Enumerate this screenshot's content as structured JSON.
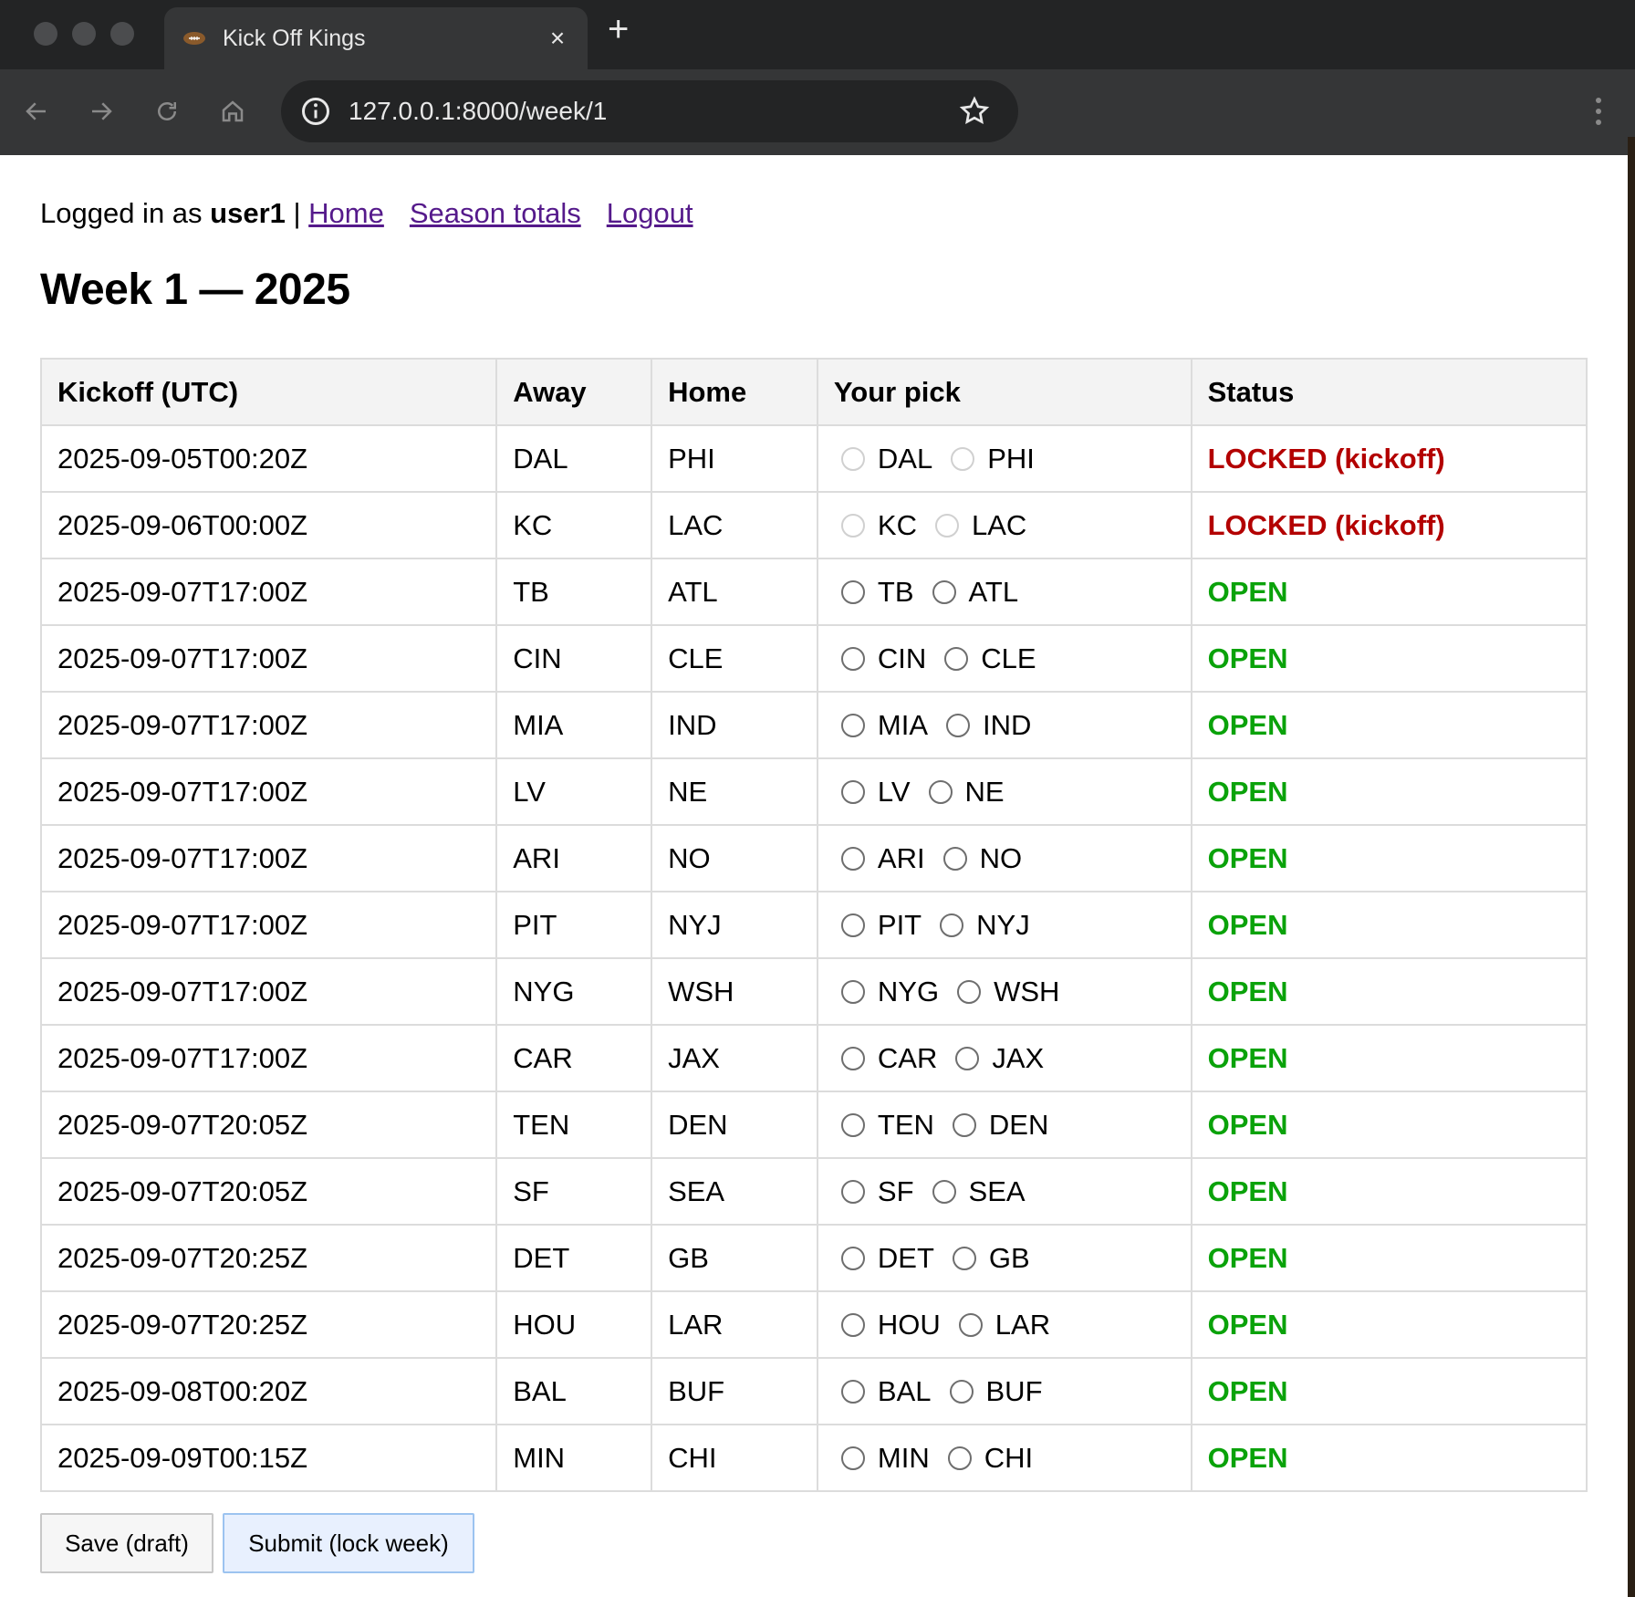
{
  "browser": {
    "tab_title": "Kick Off Kings",
    "tab_close": "×",
    "new_tab": "+",
    "url": "127.0.0.1:8000/week/1"
  },
  "userbar": {
    "prefix": "Logged in as ",
    "username": "user1",
    "separator": " | ",
    "links": {
      "home": "Home",
      "season_totals": "Season totals",
      "logout": "Logout"
    }
  },
  "page_title": "Week 1 — 2025",
  "table": {
    "headers": [
      "Kickoff (UTC)",
      "Away",
      "Home",
      "Your pick",
      "Status"
    ],
    "rows": [
      {
        "kickoff": "2025-09-05T00:20Z",
        "away": "DAL",
        "home": "PHI",
        "status": "LOCKED (kickoff)",
        "locked": true
      },
      {
        "kickoff": "2025-09-06T00:00Z",
        "away": "KC",
        "home": "LAC",
        "status": "LOCKED (kickoff)",
        "locked": true
      },
      {
        "kickoff": "2025-09-07T17:00Z",
        "away": "TB",
        "home": "ATL",
        "status": "OPEN",
        "locked": false
      },
      {
        "kickoff": "2025-09-07T17:00Z",
        "away": "CIN",
        "home": "CLE",
        "status": "OPEN",
        "locked": false
      },
      {
        "kickoff": "2025-09-07T17:00Z",
        "away": "MIA",
        "home": "IND",
        "status": "OPEN",
        "locked": false
      },
      {
        "kickoff": "2025-09-07T17:00Z",
        "away": "LV",
        "home": "NE",
        "status": "OPEN",
        "locked": false
      },
      {
        "kickoff": "2025-09-07T17:00Z",
        "away": "ARI",
        "home": "NO",
        "status": "OPEN",
        "locked": false
      },
      {
        "kickoff": "2025-09-07T17:00Z",
        "away": "PIT",
        "home": "NYJ",
        "status": "OPEN",
        "locked": false
      },
      {
        "kickoff": "2025-09-07T17:00Z",
        "away": "NYG",
        "home": "WSH",
        "status": "OPEN",
        "locked": false
      },
      {
        "kickoff": "2025-09-07T17:00Z",
        "away": "CAR",
        "home": "JAX",
        "status": "OPEN",
        "locked": false
      },
      {
        "kickoff": "2025-09-07T20:05Z",
        "away": "TEN",
        "home": "DEN",
        "status": "OPEN",
        "locked": false
      },
      {
        "kickoff": "2025-09-07T20:05Z",
        "away": "SF",
        "home": "SEA",
        "status": "OPEN",
        "locked": false
      },
      {
        "kickoff": "2025-09-07T20:25Z",
        "away": "DET",
        "home": "GB",
        "status": "OPEN",
        "locked": false
      },
      {
        "kickoff": "2025-09-07T20:25Z",
        "away": "HOU",
        "home": "LAR",
        "status": "OPEN",
        "locked": false
      },
      {
        "kickoff": "2025-09-08T00:20Z",
        "away": "BAL",
        "home": "BUF",
        "status": "OPEN",
        "locked": false
      },
      {
        "kickoff": "2025-09-09T00:15Z",
        "away": "MIN",
        "home": "CHI",
        "status": "OPEN",
        "locked": false
      }
    ]
  },
  "buttons": {
    "save": "Save (draft)",
    "submit": "Submit (lock week)"
  },
  "colors": {
    "open": "#0aa20a",
    "locked": "#b30000",
    "link": "#551a8b"
  }
}
